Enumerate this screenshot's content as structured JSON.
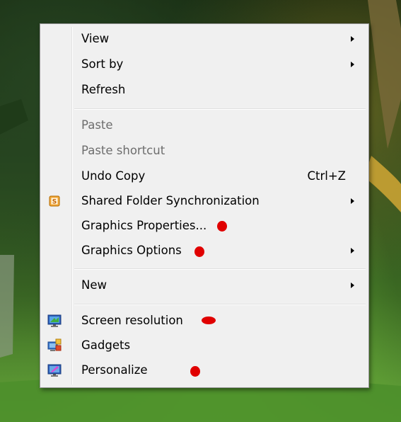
{
  "menu": {
    "items": [
      {
        "label": "View",
        "submenu": true
      },
      {
        "label": "Sort by",
        "submenu": true
      },
      {
        "label": "Refresh"
      },
      {
        "label": "Paste",
        "disabled": true
      },
      {
        "label": "Paste shortcut",
        "disabled": true
      },
      {
        "label": "Undo Copy",
        "shortcut": "Ctrl+Z"
      },
      {
        "label": "Shared Folder Synchronization",
        "submenu": true,
        "icon": "shared-folder-sync-icon",
        "icon_letter": "S"
      },
      {
        "label": "Graphics Properties...",
        "annotation": "red-dot"
      },
      {
        "label": "Graphics Options",
        "submenu": true,
        "annotation": "red-dot"
      },
      {
        "label": "New",
        "submenu": true
      },
      {
        "label": "Screen resolution",
        "icon": "screen-resolution-icon",
        "annotation": "red-dot"
      },
      {
        "label": "Gadgets",
        "icon": "gadgets-icon"
      },
      {
        "label": "Personalize",
        "icon": "personalize-icon",
        "annotation": "red-dot"
      }
    ]
  },
  "colors": {
    "menu_background": "#f0f0f0",
    "disabled_text": "#6d6d6d",
    "annotation_red": "#e00000"
  }
}
